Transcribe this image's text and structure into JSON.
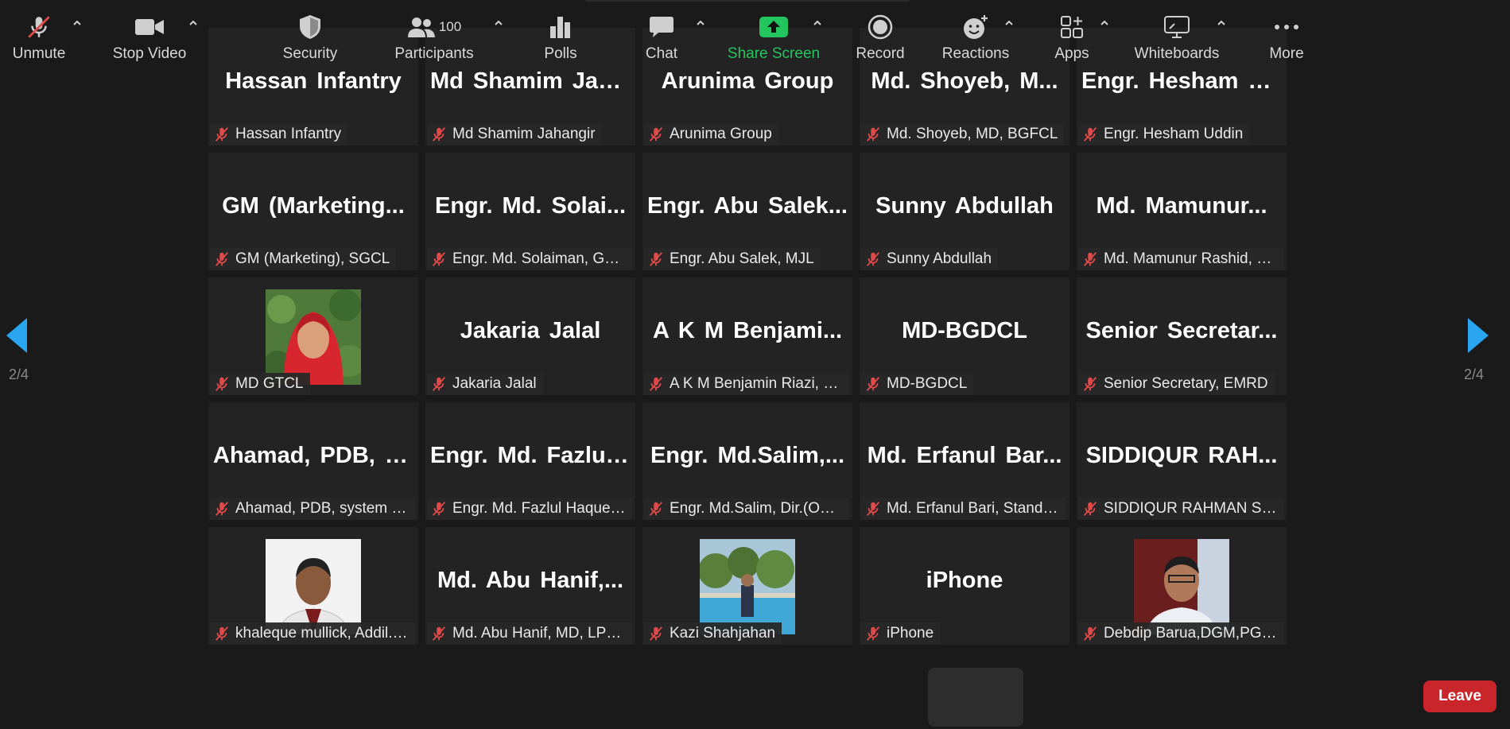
{
  "pagination": {
    "left": "2/4",
    "right": "2/4"
  },
  "tiles": [
    {
      "big": "Hassan Infantry",
      "label": "Hassan Infantry"
    },
    {
      "big": "Md Shamim Jah...",
      "label": "Md Shamim Jahangir"
    },
    {
      "big": "Arunima Group",
      "label": "Arunima Group"
    },
    {
      "big": "Md. Shoyeb, M...",
      "label": "Md. Shoyeb, MD, BGFCL"
    },
    {
      "big": "Engr. Hesham U...",
      "label": "Engr. Hesham Uddin"
    },
    {
      "big": "GM (Marketing...",
      "label": "GM (Marketing), SGCL"
    },
    {
      "big": "Engr. Md. Solai...",
      "label": "Engr. Md. Solaiman, GM_..."
    },
    {
      "big": "Engr. Abu Salek...",
      "label": "Engr. Abu Salek, MJL"
    },
    {
      "big": "Sunny Abdullah",
      "label": "Sunny Abdullah"
    },
    {
      "big": "Md. Mamunur...",
      "label": "Md. Mamunur Rashid, D..."
    },
    {
      "big": "",
      "label": "MD GTCL"
    },
    {
      "big": "Jakaria Jalal",
      "label": "Jakaria Jalal"
    },
    {
      "big": "A K M Benjami...",
      "label": "A K M Benjamin Riazi, Dir..."
    },
    {
      "big": "MD-BGDCL",
      "label": "MD-BGDCL"
    },
    {
      "big": "Senior Secretar...",
      "label": "Senior Secretary, EMRD"
    },
    {
      "big": "Ahamad, PDB, s...",
      "label": "Ahamad, PDB, system pla..."
    },
    {
      "big": "Engr. Md. Fazlul...",
      "label": "Engr. Md. Fazlul Haque, G..."
    },
    {
      "big": "Engr. Md.Salim,...",
      "label": "Engr. Md.Salim, Dir.(Oper..."
    },
    {
      "big": "Md. Erfanul Bar...",
      "label": "Md. Erfanul Bari, Standar..."
    },
    {
      "big": "SIDDIQUR RAH...",
      "label": "SIDDIQUR RAHMAN SAO..."
    },
    {
      "big": "",
      "label": "khaleque mullick, Addil. S..."
    },
    {
      "big": "Md. Abu Hanif,...",
      "label": "Md. Abu Hanif, MD, LPGL"
    },
    {
      "big": "",
      "label": "Kazi Shahjahan"
    },
    {
      "big": "iPhone",
      "label": "iPhone"
    },
    {
      "big": "",
      "label": "Debdip Barua,DGM,PGCL."
    }
  ],
  "toolbar": {
    "unmute": "Unmute",
    "stop_video": "Stop Video",
    "security": "Security",
    "participants": "Participants",
    "participants_count": "100",
    "polls": "Polls",
    "chat": "Chat",
    "share_screen": "Share Screen",
    "record": "Record",
    "reactions": "Reactions",
    "apps": "Apps",
    "whiteboards": "Whiteboards",
    "more": "More",
    "leave": "Leave"
  },
  "colors": {
    "accent_blue": "#2aa6f0",
    "share_green": "#22c55e",
    "leave_red": "#c9262b",
    "mute_red": "#e04a4a"
  }
}
